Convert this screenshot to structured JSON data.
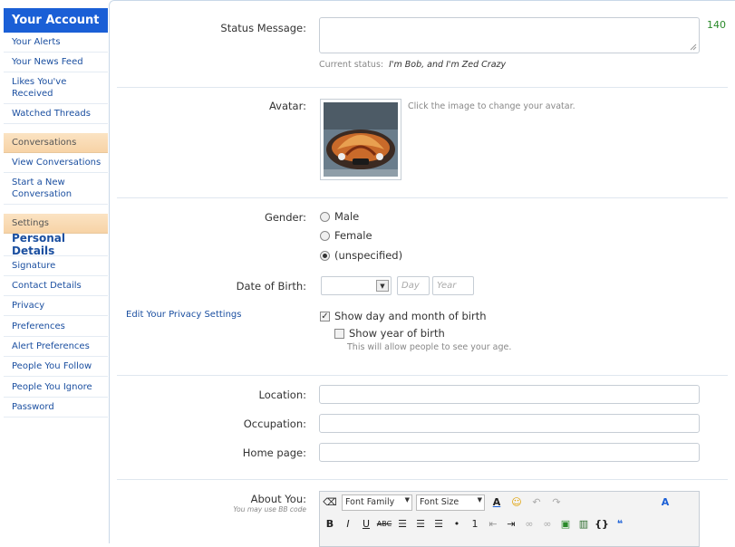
{
  "sidebar": {
    "header": "Your Account",
    "account_links": [
      "Your Alerts",
      "Your News Feed",
      "Likes You've Received",
      "Watched Threads"
    ],
    "conversations_title": "Conversations",
    "conversation_links": [
      "View Conversations",
      "Start a New Conversation"
    ],
    "settings_title": "Settings",
    "active": "Personal Details",
    "settings_links": [
      "Signature",
      "Contact Details",
      "Privacy",
      "Preferences",
      "Alert Preferences",
      "People You Follow",
      "People You Ignore",
      "Password"
    ]
  },
  "status": {
    "label": "Status Message:",
    "counter": "140",
    "current_label": "Current status:",
    "current_value": "I'm Bob, and I'm Zed Crazy"
  },
  "avatar": {
    "label": "Avatar:",
    "hint": "Click the image to change your avatar."
  },
  "gender": {
    "label": "Gender:",
    "options": [
      "Male",
      "Female",
      "(unspecified)"
    ],
    "selected": "(unspecified)"
  },
  "dob": {
    "label": "Date of Birth:",
    "day_placeholder": "Day",
    "year_placeholder": "Year",
    "privacy_link": "Edit Your Privacy Settings",
    "show_day_month": "Show day and month of birth",
    "show_day_month_checked": true,
    "show_year": "Show year of birth",
    "show_year_checked": false,
    "year_hint": "This will allow people to see your age."
  },
  "location": {
    "label": "Location:"
  },
  "occupation": {
    "label": "Occupation:"
  },
  "homepage": {
    "label": "Home page:"
  },
  "about": {
    "label": "About You:",
    "hint": "You may use BB code",
    "font_family": "Font Family",
    "font_size": "Font Size"
  },
  "colors": {
    "accent": "#1a5fd6",
    "link": "#1b4fa0",
    "counter": "#2a8a2a"
  }
}
